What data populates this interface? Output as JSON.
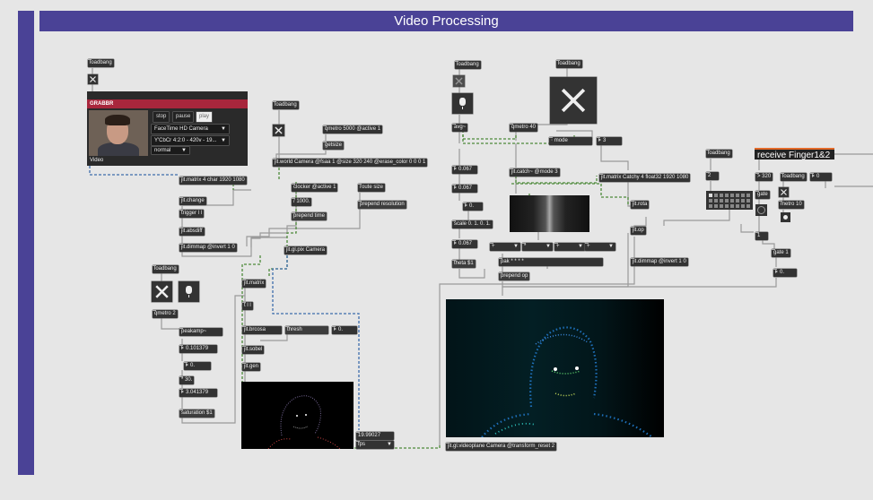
{
  "title": "Video Processing",
  "grabber": {
    "header": "GRABBR",
    "buttons": [
      "stop",
      "pause",
      "play"
    ],
    "camera_select": "FaceTime HD Camera",
    "format_select": "Y'CbCr 4:2:0 - 420v - 19...",
    "mode_select": "normal",
    "footer": "Video"
  },
  "objects": {
    "loadbang": "loadbang",
    "matrix_4char": "jit.matrix 4 char 1920 1080",
    "change": "jit.change",
    "trigger": "trigger l l",
    "absdiff": "jit.absdiff",
    "dimmap_a": "jit.dimmap @invert 1 0",
    "qmetro_5000": "qmetro 5000 @active 1",
    "getsize": "getsize",
    "world": "jit.world Camera @fsaa 1 @size 320 240 @erase_color 0 0 0 1",
    "clocker": "clocker @active 1",
    "div1000": "/ 1000.",
    "prepend_time": "prepend time",
    "route_size": "route size",
    "prepend_resolution": "prepend resolution",
    "gl_pix": "jit.gl.pix Camera",
    "jit_matrix": "jit.matrix",
    "t_ll": "t l l",
    "brcosa": "jit.brcosa",
    "thresh": "thresh",
    "sobel": "jit.sobel",
    "gen": "jit.gen",
    "qmetro_2": "qmetro 2",
    "peakamp": "peakamp~",
    "times30": "* 30.",
    "saturation": "saturation $1",
    "fps": "fps",
    "avg": "avg~",
    "scale": "scale 0. 1. 0. 1.",
    "theta": "theta $1",
    "qmetro_40": "qmetro 40",
    "mode": "mode",
    "catch": "jit.catch~ @mode 3",
    "matrix_catchy": "jit.matrix Catchy 4 float32 1920 1080",
    "rota": "jit.rota",
    "op": "jit.op",
    "dimmap_b": "jit.dimmap @invert 1 0",
    "pak": "pak * * * *",
    "prepend_op": "prepend op",
    "videoplane": "jit.gl.videoplane Camera @transform_reset 2",
    "receive": "receive Finger1&2",
    "gt320": "> 320",
    "gate": "gate",
    "metro10": "metro 10",
    "gate1": "gate 1"
  },
  "numbers": {
    "n_0101379": "0.101379",
    "n_0a": "0.",
    "n_3041379": "3.041379",
    "n_thresh": "0.",
    "fps_value": "19.99027",
    "avg_1": "0.067",
    "avg_2": "0.067",
    "avg_3": "0.",
    "avg_4": "0.067",
    "mode_val": "3",
    "two": "2",
    "zero_r": "0",
    "one": "1",
    "zero_g": "0."
  },
  "operators": [
    "+",
    "*",
    "+",
    "+"
  ],
  "colors": {
    "accent": "#4a4296",
    "patchcord_gray": "#9a9a9a",
    "patchcord_green": "#4d8a3a",
    "patchcord_blue": "#3d6dab",
    "grabber_red": "#a8263c",
    "receive_orange": "#e36a2a"
  }
}
